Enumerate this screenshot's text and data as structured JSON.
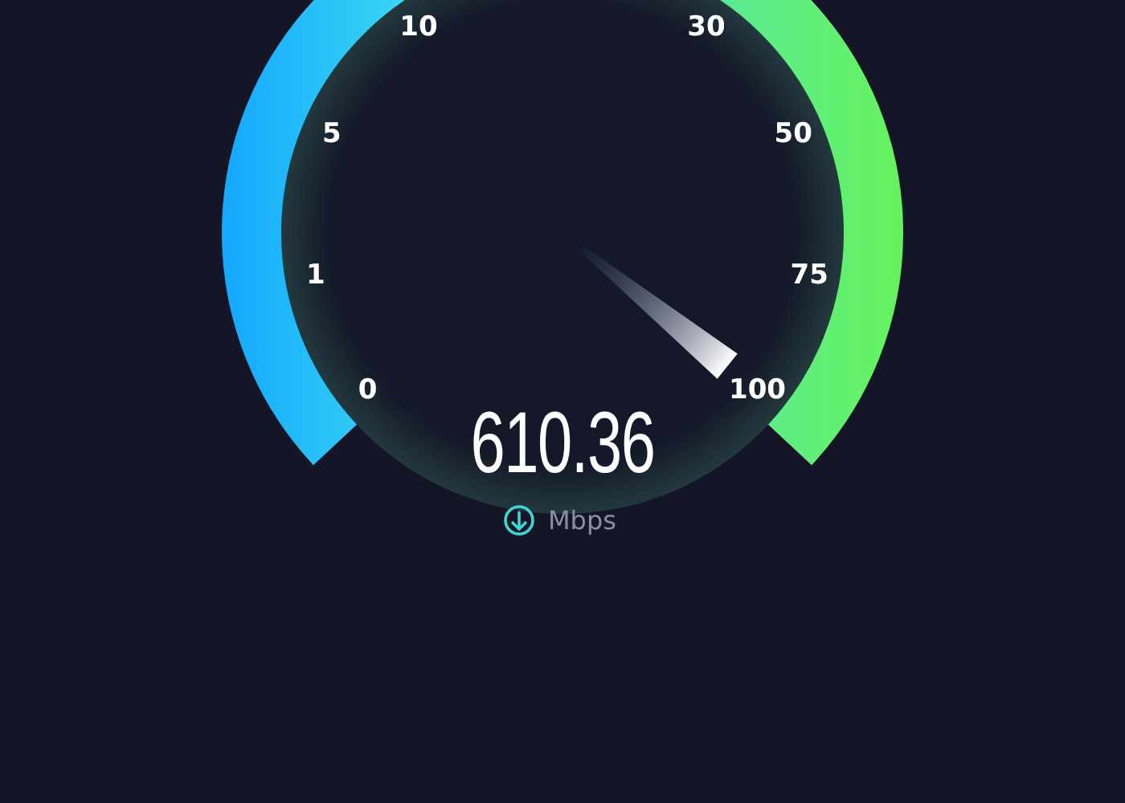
{
  "gauge": {
    "ticks": [
      "0",
      "1",
      "5",
      "10",
      "30",
      "50",
      "75",
      "100"
    ]
  },
  "reading": {
    "value": "610.36",
    "unit": "Mbps"
  }
}
